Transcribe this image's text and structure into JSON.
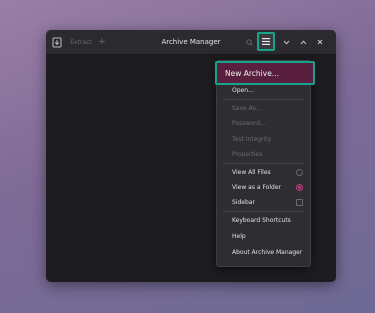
{
  "window": {
    "title": "Archive Manager",
    "toolbar": {
      "extract_label": "Extract"
    }
  },
  "menu": {
    "items": [
      {
        "label": "New Archive…",
        "enabled": true
      },
      {
        "label": "Open…",
        "enabled": true
      },
      {
        "label": "Save As…",
        "enabled": false
      },
      {
        "label": "Password…",
        "enabled": false
      },
      {
        "label": "Test Integrity",
        "enabled": false
      },
      {
        "label": "Properties",
        "enabled": false
      },
      {
        "label": "View All Files",
        "enabled": true,
        "selected": false
      },
      {
        "label": "View as a Folder",
        "enabled": true,
        "selected": true
      },
      {
        "label": "Sidebar",
        "enabled": true,
        "checked": false
      },
      {
        "label": "Keyboard Shortcuts",
        "enabled": true
      },
      {
        "label": "Help",
        "enabled": true
      },
      {
        "label": "About Archive Manager",
        "enabled": true
      }
    ]
  },
  "colors": {
    "accent": "#c4408a",
    "highlight_outline": "#1aa38c",
    "selected_bg": "#5a1f3e"
  }
}
